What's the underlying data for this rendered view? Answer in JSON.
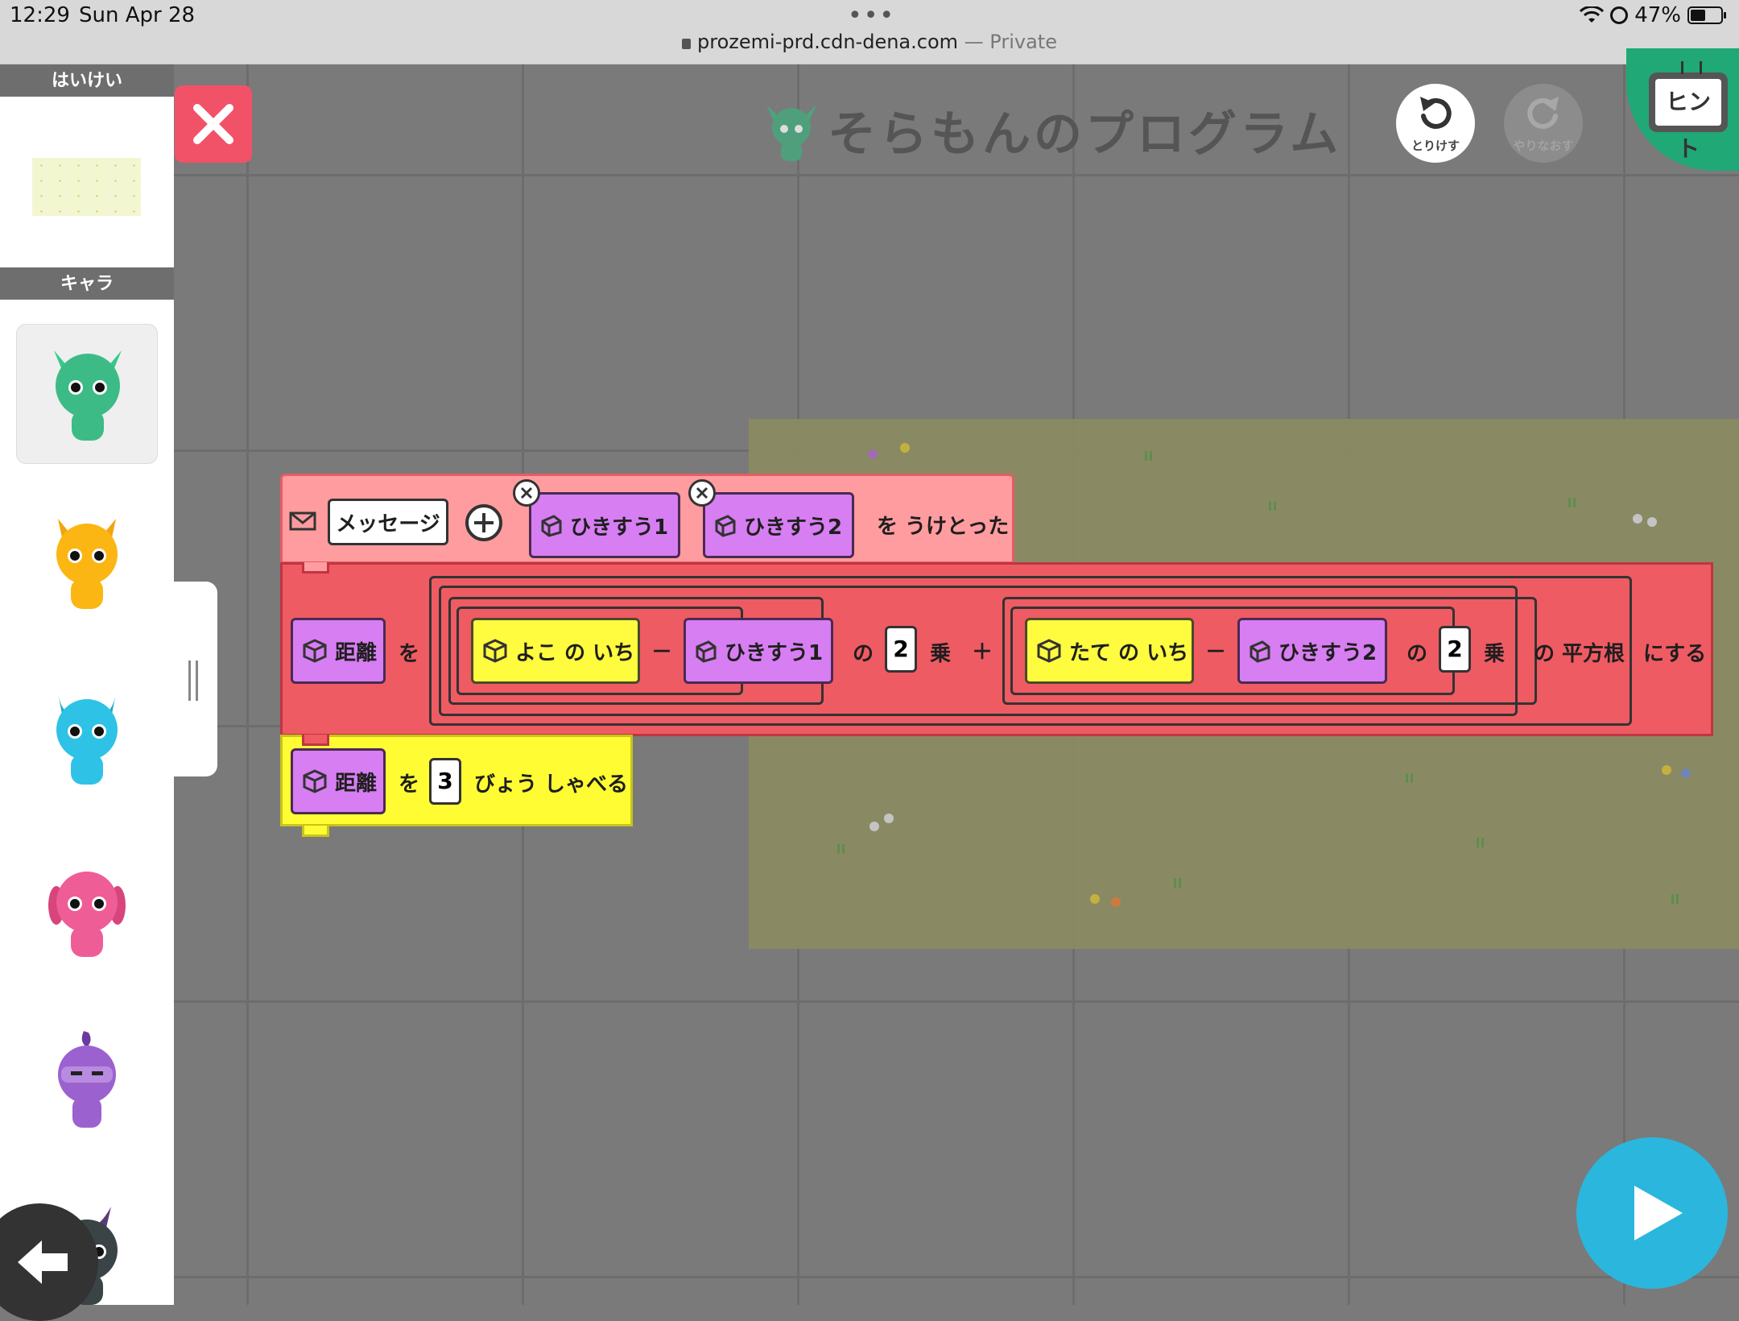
{
  "status_bar": {
    "time": "12:29",
    "date": "Sun Apr 28",
    "url": "prozemi-prd.cdn-dena.com",
    "private_label": "— Private",
    "battery": "47%"
  },
  "left_panel": {
    "background_header": "はいけい",
    "character_header": "キャラ",
    "characters": [
      "green-monster",
      "yellow-monster",
      "blue-monster",
      "pink-monster",
      "purple-ninja",
      "dark-monster"
    ]
  },
  "header": {
    "title": "そらもんのプログラム",
    "undo_label": "とりけす",
    "redo_label": "やりなおす",
    "hint_label": "ヒント"
  },
  "blocks": {
    "message_block": {
      "message_label": "メッセージ",
      "param1": "ひきすう1",
      "param2": "ひきすう2",
      "suffix": "を うけとった"
    },
    "set_block": {
      "variable": "距離",
      "wo": "を",
      "x_pos": "よこ の いち",
      "minus1": "－",
      "arg1": "ひきすう1",
      "no1": "の",
      "power1": "2",
      "jou1": "乗",
      "plus": "＋",
      "y_pos": "たて の いち",
      "minus2": "－",
      "arg2": "ひきすう2",
      "no2": "の",
      "power2": "2",
      "jou2": "乗",
      "sqrt_label": "の 平方根",
      "suffix": "にする"
    },
    "speak_block": {
      "variable": "距離",
      "wo": "を",
      "seconds": "3",
      "suffix": "びょう しゃべる"
    }
  },
  "colors": {
    "message_block": "#ff9c9f",
    "set_block": "#ef5b63",
    "speak_block": "#fffc33",
    "variable_block": "#d77ef2",
    "position_block": "#fffb3f",
    "play_button": "#2bb6dd",
    "hint_button": "#20a876",
    "close_button": "#f15268"
  }
}
